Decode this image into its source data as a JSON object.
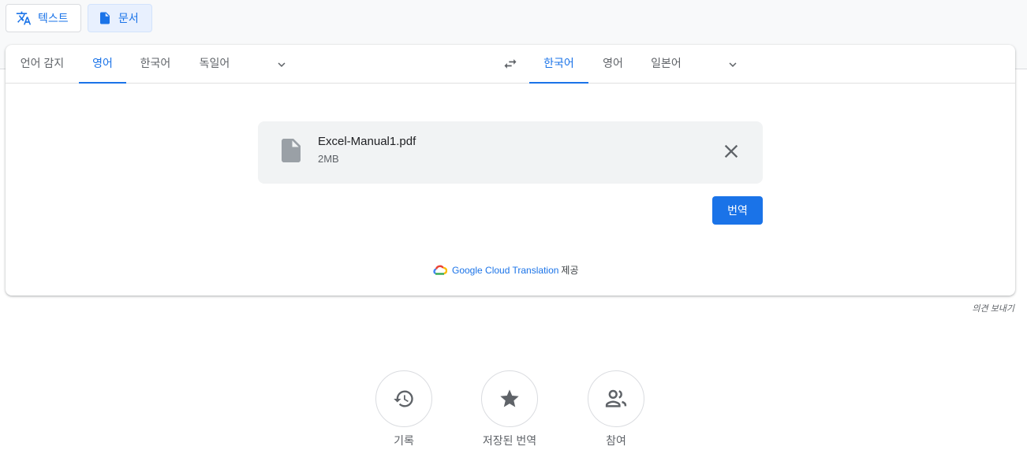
{
  "modes": [
    {
      "label": "텍스트",
      "icon": "translate-icon"
    },
    {
      "label": "문서",
      "icon": "document-icon",
      "active": true
    }
  ],
  "source_langs": [
    "언어 감지",
    "영어",
    "한국어",
    "독일어"
  ],
  "source_selected": "영어",
  "target_langs": [
    "한국어",
    "영어",
    "일본어"
  ],
  "target_selected": "한국어",
  "file": {
    "name": "Excel-Manual1.pdf",
    "size": "2MB"
  },
  "translate_label": "번역",
  "powered": {
    "link": "Google Cloud Translation",
    "suffix": "제공"
  },
  "feedback": "의견 보내기",
  "bottom": [
    {
      "label": "기록",
      "icon": "history-icon"
    },
    {
      "label": "저장된 번역",
      "icon": "star-icon"
    },
    {
      "label": "참여",
      "icon": "community-icon"
    }
  ],
  "colors": {
    "accent": "#1a73e8"
  }
}
